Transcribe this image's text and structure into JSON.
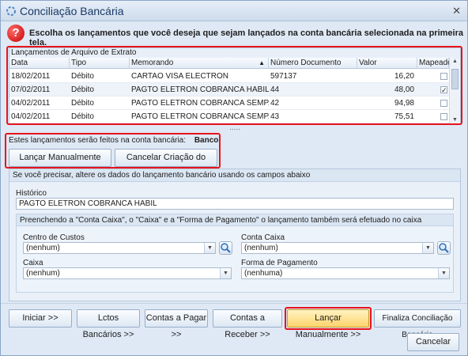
{
  "window": {
    "title": "Conciliação Bancária",
    "close": "✕"
  },
  "instruction": "Escolha os lançamentos que você deseja que sejam lançados na conta bancária selecionada na primeira tela.",
  "grid": {
    "caption": "Lançamentos de Arquivo de Extrato",
    "columns": [
      "Data",
      "Tipo",
      "Memorando",
      "Número Documento",
      "Valor",
      "Mapeado"
    ],
    "rows": [
      {
        "data": "18/02/2011",
        "tipo": "Débito",
        "memorando": "CARTAO VISA ELECTRON",
        "numero": "597137",
        "valor": "16,20",
        "mapeado": ""
      },
      {
        "data": "07/02/2011",
        "tipo": "Débito",
        "memorando": "PAGTO ELETRON  COBRANCA HABIL ENTER...",
        "numero": "44",
        "valor": "48,00",
        "mapeado": "✓"
      },
      {
        "data": "04/02/2011",
        "tipo": "Débito",
        "memorando": "PAGTO ELETRON  COBRANCA SEMPARAR D...",
        "numero": "42",
        "valor": "94,98",
        "mapeado": ""
      },
      {
        "data": "04/02/2011",
        "tipo": "Débito",
        "memorando": "PAGTO ELETRON  COBRANCA SEMPARAR J...",
        "numero": "43",
        "valor": "75,51",
        "mapeado": ""
      }
    ],
    "resize_grip": "....."
  },
  "note": {
    "text": "Estes lançamentos serão feitos na conta bancária:",
    "bank": "Banco"
  },
  "actions": {
    "lancar": "Lançar Manualmente",
    "cancelar": "Cancelar Criação do Lançamento"
  },
  "form": {
    "caption": "Se você precisar, altere os dados do lançamento bancário usando os campos abaixo",
    "historico_label": "Histórico",
    "historico_value": "PAGTO ELETRON  COBRANCA HABIL",
    "inner_caption": "Preenchendo a \"Conta Caixa\", o \"Caixa\" e a \"Forma de Pagamento\" o lançamento também será efetuado no caixa",
    "centro_label": "Centro de Custos",
    "centro_value": "(nenhum)",
    "conta_label": "Conta Caixa",
    "conta_value": "(nenhum)",
    "caixa_label": "Caixa",
    "caixa_value": "(nenhum)",
    "forma_label": "Forma de Pagamento",
    "forma_value": "(nenhuma)"
  },
  "nav": [
    "Iniciar >>",
    "Lctos Bancários >>",
    "Contas a Pagar >>",
    "Contas a Receber >>",
    "Lançar Manualmente >>",
    "Finaliza Conciliação Bancária"
  ],
  "cancel": "Cancelar",
  "colors": {
    "highlight_border": "#e8141c",
    "accent": "#1a3a66"
  }
}
